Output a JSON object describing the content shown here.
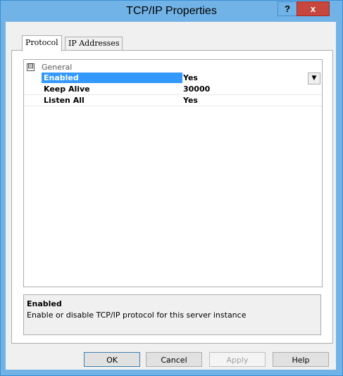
{
  "window": {
    "title": "TCP/IP Properties",
    "help_glyph": "?",
    "close_glyph": "x"
  },
  "tabs": [
    {
      "label": "Protocol",
      "active": true
    },
    {
      "label": "IP Addresses",
      "active": false
    }
  ],
  "grid": {
    "category": {
      "label": "General",
      "toggle": "⊟"
    },
    "properties": [
      {
        "name": "Enabled",
        "value": "Yes",
        "selected": true
      },
      {
        "name": "Keep Alive",
        "value": "30000",
        "selected": false
      },
      {
        "name": "Listen All",
        "value": "Yes",
        "selected": false
      }
    ],
    "dropdown_glyph": "▼"
  },
  "description": {
    "title": "Enabled",
    "text": "Enable or disable TCP/IP protocol for this server instance"
  },
  "buttons": {
    "ok": "OK",
    "cancel": "Cancel",
    "apply": "Apply",
    "help": "Help"
  },
  "colors": {
    "frame": "#71b3e7",
    "close": "#c7463d",
    "selection": "#3399ff"
  }
}
